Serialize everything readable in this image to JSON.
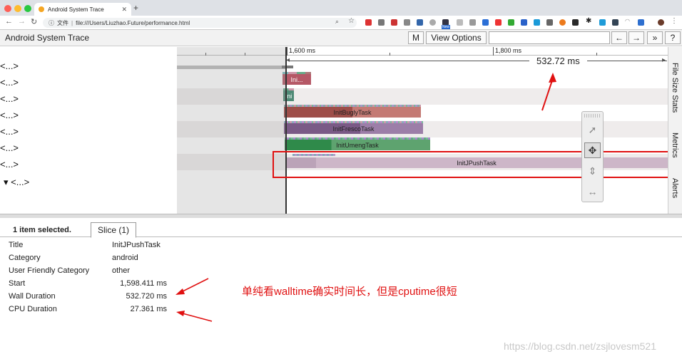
{
  "browser": {
    "tab_title": "Android System Trace",
    "new_tab": "+",
    "back": "←",
    "forward": "→",
    "reload": "↻",
    "scheme_label": "文件",
    "url": "file:///Users/Liuzhao.Future/performance.html",
    "ext_badge": "New"
  },
  "toolbar": {
    "title": "Android System Trace",
    "m_label": "M",
    "view_options_label": "View Options",
    "prev_label": "←",
    "next_label": "→",
    "more_label": "»",
    "help_label": "?"
  },
  "rows": {
    "labels": [
      "<...>",
      "<...>",
      "<...>",
      "<...>",
      "<...>",
      "<...>",
      "<...>",
      "▾  <...>"
    ]
  },
  "ruler": {
    "tick_1600": "1,600 ms",
    "tick_1800": "1,800 ms"
  },
  "slices": {
    "ini1": "Ini...",
    "ini2": "Ini",
    "bugly": "InitBuglyTask",
    "fresco": "InitFrescoTask",
    "umeng": "InitUmengTask",
    "jpush": "InitJPushTask"
  },
  "selection_duration": "532.72 ms",
  "sidebar": {
    "file_size_stats": "File Size Stats",
    "metrics": "Metrics",
    "alerts": "Alerts"
  },
  "tools": [
    "select-icon",
    "pan-icon",
    "zoom-icon",
    "timing-icon"
  ],
  "panel": {
    "selected_count": "1 item selected.",
    "slice_tab": "Slice (1)",
    "props": [
      {
        "name": "Title",
        "value": "InitJPushTask"
      },
      {
        "name": "Category",
        "value": "android"
      },
      {
        "name": "User Friendly Category",
        "value": "other"
      },
      {
        "name": "Start",
        "value": "1,598.411 ms"
      },
      {
        "name": "Wall Duration",
        "value": "532.720 ms"
      },
      {
        "name": "CPU Duration",
        "value": "27.361 ms"
      }
    ]
  },
  "annotation": "单纯看walltime确实时间长，但是cputime很短",
  "watermark": "https://blog.csdn.net/zsjlovesm521",
  "colors": {
    "annotation_red": "#e01010",
    "bugly": "#9e4e49",
    "fresco": "#7a5a86",
    "umeng": "#2f8a4a",
    "jpush": "#cdb6c8"
  }
}
